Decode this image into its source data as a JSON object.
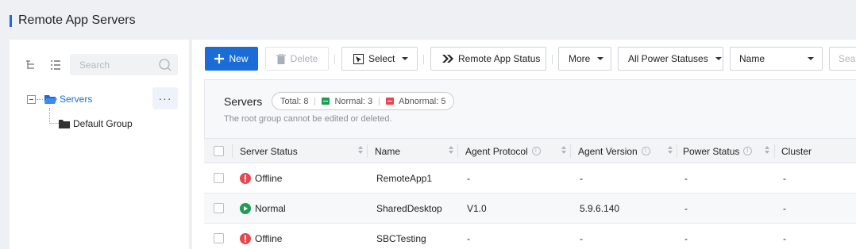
{
  "page": {
    "title": "Remote App Servers",
    "accent_color": "#1a6dd6"
  },
  "tree": {
    "search_placeholder": "Search",
    "more_label": "···",
    "root_label": "Servers",
    "child_label": "Default Group"
  },
  "toolbar": {
    "new_label": "New",
    "delete_label": "Delete",
    "select_label": "Select",
    "status_label": "Remote App Status",
    "more_label": "More",
    "power_filter": "All Power Statuses",
    "field_filter": "Name",
    "search_placeholder": "Sea"
  },
  "summary": {
    "title": "Servers",
    "total": "Total: 8",
    "normal": "Normal: 3",
    "abnormal": "Abnormal: 5",
    "note": "The root group cannot be edited or deleted.",
    "normal_color": "#1f9d55",
    "abnormal_color": "#e5484d"
  },
  "table": {
    "columns": [
      "Server Status",
      "Name",
      "Agent Protocol",
      "Agent Version",
      "Power Status",
      "Cluster"
    ],
    "rows": [
      {
        "status": "Offline",
        "status_kind": "offline",
        "name": "RemoteApp1",
        "protocol": "-",
        "version": "-",
        "power": "-",
        "cluster": "-"
      },
      {
        "status": "Normal",
        "status_kind": "normal",
        "name": "SharedDesktop",
        "protocol": "V1.0",
        "version": "5.9.6.140",
        "power": "-",
        "cluster": "-"
      },
      {
        "status": "Offline",
        "status_kind": "offline",
        "name": "SBCTesting",
        "protocol": "-",
        "version": "-",
        "power": "-",
        "cluster": "-"
      }
    ]
  }
}
